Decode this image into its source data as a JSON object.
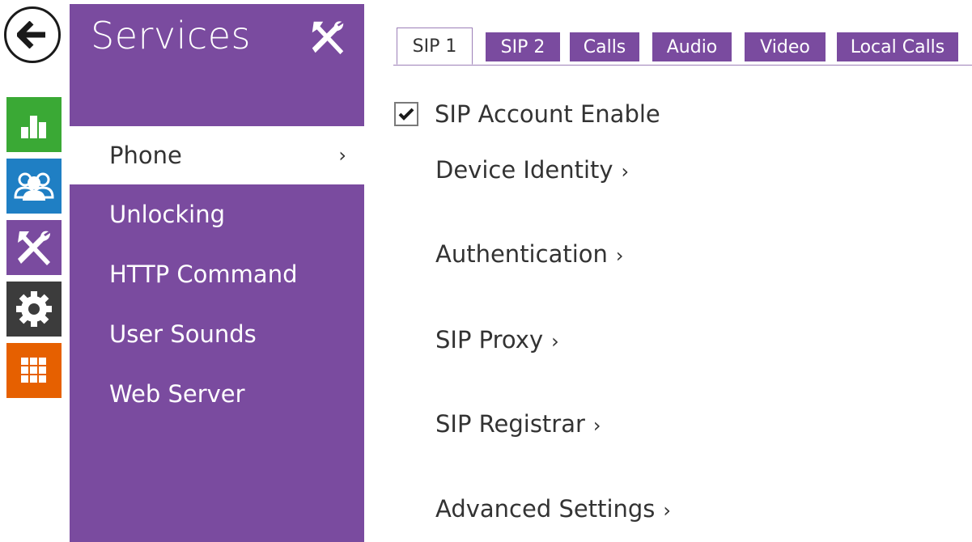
{
  "rail": {
    "back_icon": "arrow-left-icon",
    "items": [
      {
        "icon": "bar-chart-icon",
        "color": "#3aa935"
      },
      {
        "icon": "users-icon",
        "color": "#1f7fc4"
      },
      {
        "icon": "tools-icon",
        "color": "#7a4b9f"
      },
      {
        "icon": "gear-icon",
        "color": "#3c3c3c"
      },
      {
        "icon": "grid-icon",
        "color": "#e66000"
      }
    ]
  },
  "panel": {
    "title": "Services",
    "title_icon": "tools-icon",
    "menu": [
      {
        "label": "Phone",
        "active": true,
        "chevron": "›"
      },
      {
        "label": "Unlocking"
      },
      {
        "label": "HTTP Command"
      },
      {
        "label": "User Sounds"
      },
      {
        "label": "Web Server"
      }
    ]
  },
  "tabs": [
    {
      "label": "SIP 1",
      "active": true
    },
    {
      "label": "SIP 2"
    },
    {
      "label": "Calls"
    },
    {
      "label": "Audio"
    },
    {
      "label": "Video"
    },
    {
      "label": "Local Calls"
    }
  ],
  "content": {
    "sip_account_enable": {
      "label": "SIP Account Enable",
      "checked": true
    },
    "sections": [
      {
        "label": "Device Identity",
        "arrow": "›"
      },
      {
        "label": "Authentication",
        "arrow": "›"
      },
      {
        "label": "SIP Proxy",
        "arrow": "›"
      },
      {
        "label": "SIP Registrar",
        "arrow": "›"
      },
      {
        "label": "Advanced Settings",
        "arrow": "›"
      }
    ]
  },
  "colors": {
    "accent": "#7a4b9f",
    "status_green": "#3aa935",
    "directory_blue": "#1f7fc4",
    "settings_dark": "#3c3c3c",
    "system_orange": "#e66000"
  }
}
